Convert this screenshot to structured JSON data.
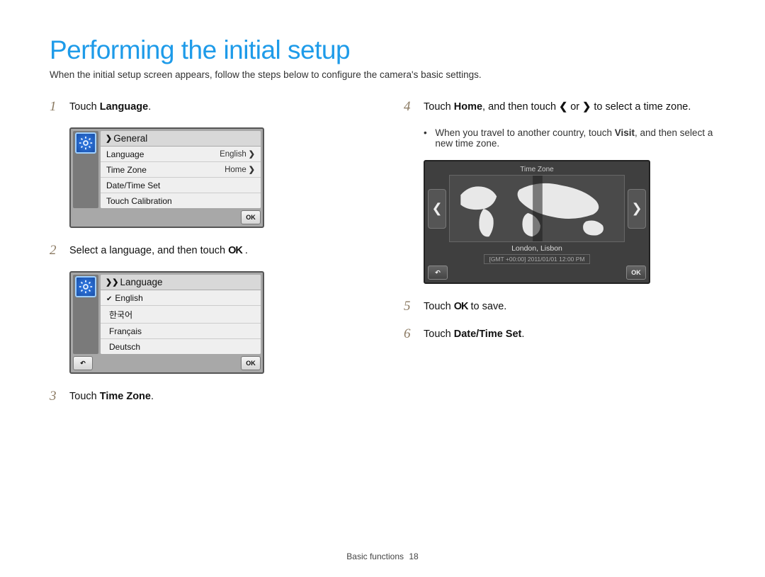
{
  "title": "Performing the initial setup",
  "intro": "When the initial setup screen appears, follow the steps below to configure the camera's basic settings.",
  "steps": {
    "s1": {
      "num": "1",
      "pre": "Touch ",
      "bold": "Language",
      "post": "."
    },
    "s2": {
      "num": "2",
      "text_pre": "Select a language, and then touch ",
      "ok": "OK",
      "text_post": " ."
    },
    "s3": {
      "num": "3",
      "pre": "Touch ",
      "bold": "Time Zone",
      "post": "."
    },
    "s4": {
      "num": "4",
      "pre": "Touch ",
      "bold": "Home",
      "mid": ", and then touch ",
      "left": "❮",
      "or": " or ",
      "right": "❯",
      "post": " to select a time zone."
    },
    "s4_sub": {
      "bullet": "•",
      "pre": "When you travel to another country, touch ",
      "bold": "Visit",
      "post": ", and then select a new time zone."
    },
    "s5": {
      "num": "5",
      "pre": "Touch ",
      "ok": "OK",
      "post": " to save."
    },
    "s6": {
      "num": "6",
      "pre": "Touch ",
      "bold": "Date/Time Set",
      "post": "."
    }
  },
  "panel_general": {
    "breadcrumb_mark": "❯",
    "breadcrumb": "General",
    "rows": [
      {
        "label": "Language",
        "value": "English",
        "chev": "❯"
      },
      {
        "label": "Time Zone",
        "value": "Home",
        "chev": "❯"
      },
      {
        "label": "Date/Time Set",
        "value": "",
        "chev": ""
      },
      {
        "label": "Touch Calibration",
        "value": "",
        "chev": ""
      }
    ],
    "ok": "OK"
  },
  "panel_language": {
    "breadcrumb_mark": "❯❯",
    "breadcrumb": "Language",
    "options": [
      {
        "check": "✔",
        "label": "English"
      },
      {
        "check": "",
        "label": "한국어"
      },
      {
        "check": "",
        "label": "Français"
      },
      {
        "check": "",
        "label": "Deutsch"
      }
    ],
    "back": "↶",
    "ok": "OK"
  },
  "panel_timezone": {
    "title": "Time Zone",
    "left": "❮",
    "right": "❯",
    "city": "London, Lisbon",
    "date": "[GMT +00:00]  2011/01/01 12:00 PM",
    "back": "↶",
    "ok": "OK"
  },
  "footer": {
    "section": "Basic functions",
    "page": "18"
  }
}
